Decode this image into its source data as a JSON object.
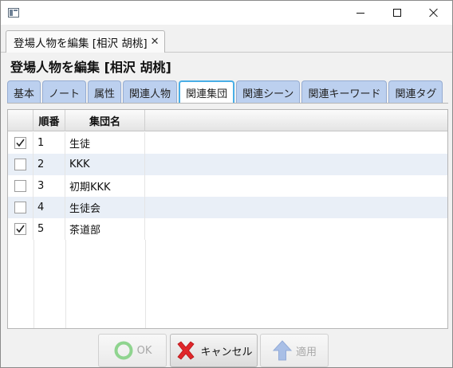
{
  "window": {
    "controls": {
      "minimize_icon": "minimize-icon",
      "maximize_icon": "maximize-icon",
      "close_icon": "close-icon"
    }
  },
  "doc_tab": {
    "label": "登場人物を編集 [相沢 胡桃]",
    "close_glyph": "✕"
  },
  "header": {
    "title": "登場人物を編集 [相沢 胡桃]"
  },
  "subtabs": [
    {
      "label": "基本",
      "active": false
    },
    {
      "label": "ノート",
      "active": false
    },
    {
      "label": "属性",
      "active": false
    },
    {
      "label": "関連人物",
      "active": false
    },
    {
      "label": "関連集団",
      "active": true
    },
    {
      "label": "関連シーン",
      "active": false
    },
    {
      "label": "関連キーワード",
      "active": false
    },
    {
      "label": "関連タグ",
      "active": false
    }
  ],
  "table": {
    "columns": {
      "check": "",
      "order": "順番",
      "name": "集団名"
    },
    "rows": [
      {
        "checked": true,
        "order": "1",
        "name": "生徒"
      },
      {
        "checked": false,
        "order": "2",
        "name": "KKK"
      },
      {
        "checked": false,
        "order": "3",
        "name": "初期KKK"
      },
      {
        "checked": false,
        "order": "4",
        "name": "生徒会"
      },
      {
        "checked": true,
        "order": "5",
        "name": "茶道部"
      }
    ]
  },
  "buttons": {
    "ok": {
      "label": "OK",
      "enabled": false,
      "icon": "ok-circle-icon",
      "color": "#8fd48f"
    },
    "cancel": {
      "label": "キャンセル",
      "enabled": true,
      "icon": "red-x-icon",
      "color": "#e0262a"
    },
    "apply": {
      "label": "適用",
      "enabled": false,
      "icon": "up-arrow-icon",
      "color": "#a9bfe6"
    }
  }
}
